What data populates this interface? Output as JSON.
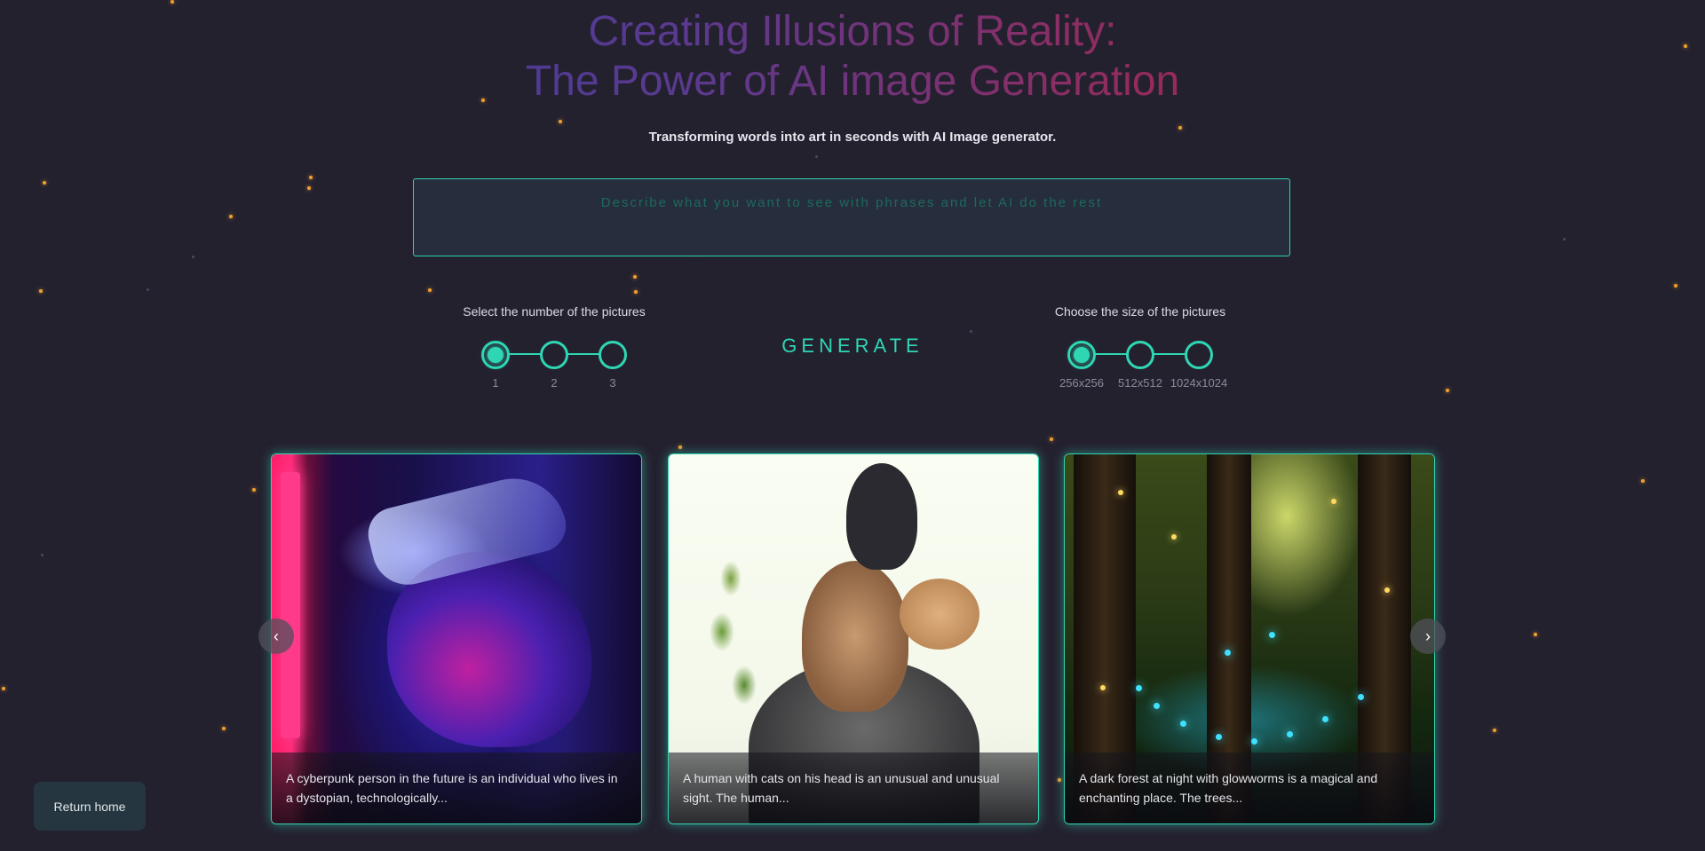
{
  "header": {
    "title_line1": "Creating Illusions of Reality:",
    "title_line2": "The Power of AI image Generation",
    "subtitle": "Transforming words into art in seconds with AI Image generator."
  },
  "prompt": {
    "placeholder": "Describe what you want to see with phrases and let AI do the rest",
    "value": ""
  },
  "count_selector": {
    "label": "Select the number of the pictures",
    "options": [
      "1",
      "2",
      "3"
    ],
    "selected": "1"
  },
  "generate_label": "GENERATE",
  "size_selector": {
    "label": "Choose the size of the pictures",
    "options": [
      "256x256",
      "512x512",
      "1024x1024"
    ],
    "selected": "256x256"
  },
  "gallery": {
    "items": [
      {
        "caption": "A cyberpunk person in the future is an individual who lives in a dystopian, technologically..."
      },
      {
        "caption": "A human with cats on his head is an unusual and unusual sight. The human..."
      },
      {
        "caption": "A dark forest at night with glowworms is a magical and enchanting place. The trees..."
      }
    ],
    "prev_icon": "‹",
    "next_icon": "›"
  },
  "footer": {
    "return_home_label": "Return home"
  },
  "colors": {
    "background": "#24212f",
    "accent": "#2fd6b4",
    "particle": "#f0a030"
  }
}
